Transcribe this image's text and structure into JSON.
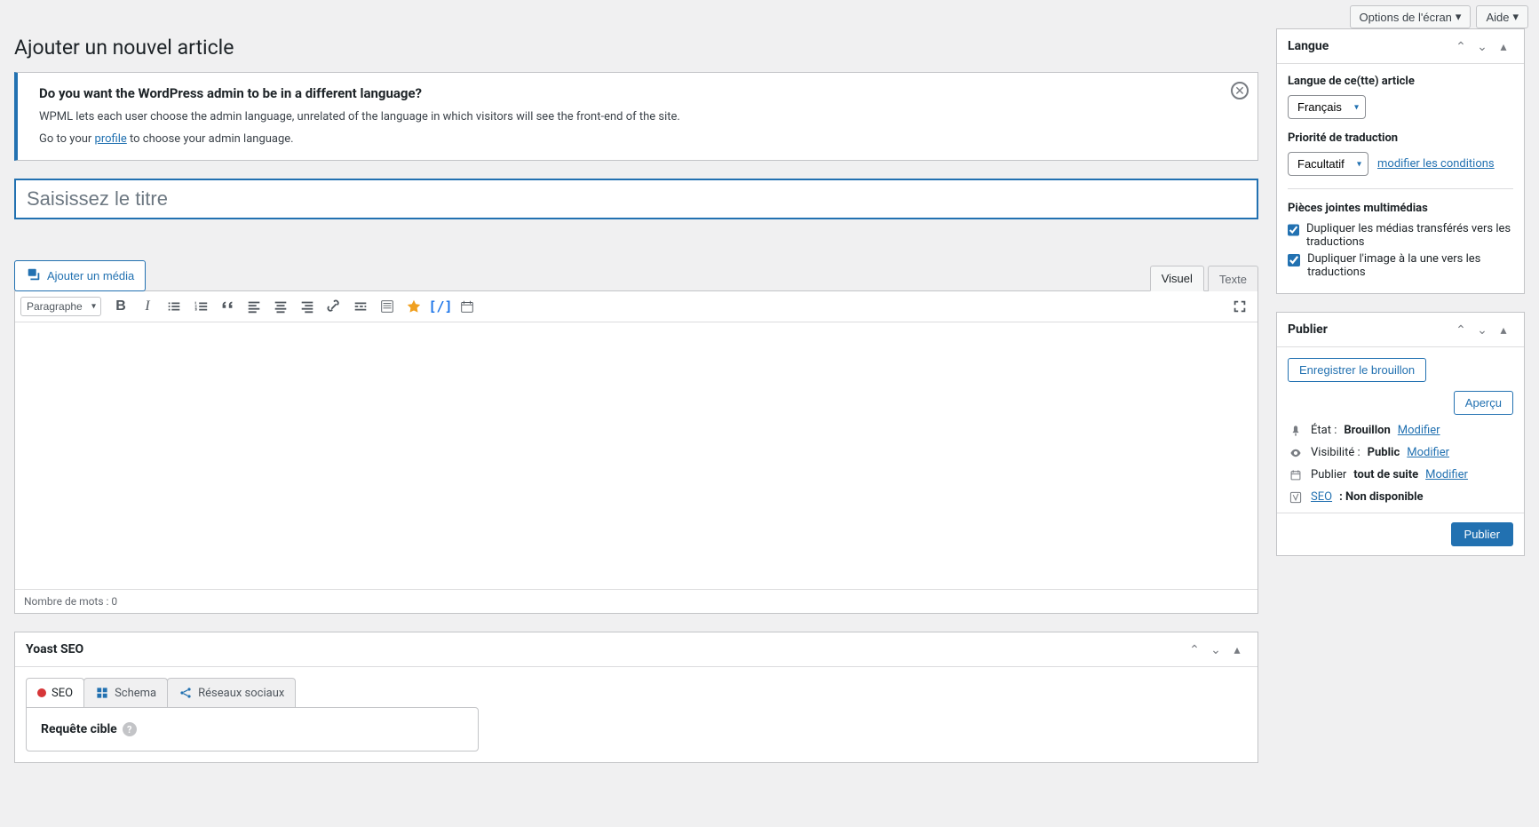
{
  "topbar": {
    "screen_options": "Options de l'écran",
    "help": "Aide"
  },
  "page_title": "Ajouter un nouvel article",
  "notice": {
    "heading": "Do you want the WordPress admin to be in a different language?",
    "line1": "WPML lets each user choose the admin language, unrelated of the language in which visitors will see the front-end of the site.",
    "line2_prefix": "Go to your ",
    "line2_link": "profile",
    "line2_suffix": " to choose your admin language."
  },
  "title_placeholder": "Saisissez le titre",
  "media_button": "Ajouter un média",
  "editor_tabs": {
    "visual": "Visuel",
    "text": "Texte"
  },
  "format_select": "Paragraphe",
  "word_count": "Nombre de mots : 0",
  "yoast": {
    "box_title": "Yoast SEO",
    "tabs": {
      "seo": "SEO",
      "schema": "Schema",
      "social": "Réseaux sociaux"
    },
    "focus_label": "Requête cible"
  },
  "langbox": {
    "title": "Langue",
    "lang_label": "Langue de ce(tte) article",
    "lang_value": "Français",
    "priority_label": "Priorité de traduction",
    "priority_value": "Facultatif",
    "modify_conditions": "modifier les conditions",
    "attachments_heading": "Pièces jointes multimédias",
    "dup_media": "Dupliquer les médias transférés vers les traductions",
    "dup_featured": "Dupliquer l'image à la une vers les traductions"
  },
  "publishbox": {
    "title": "Publier",
    "save_draft": "Enregistrer le brouillon",
    "preview": "Aperçu",
    "state_label": "État :",
    "state_value": "Brouillon",
    "visibility_label": "Visibilité :",
    "visibility_value": "Public",
    "schedule_label": "Publier",
    "schedule_value": "tout de suite",
    "seo_label": "SEO",
    "seo_value": ": Non disponible",
    "edit": "Modifier",
    "publish": "Publier"
  }
}
